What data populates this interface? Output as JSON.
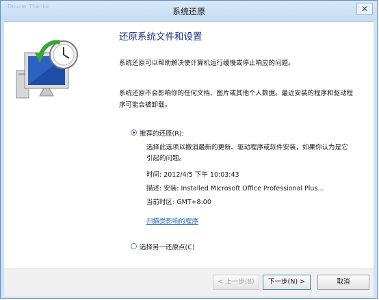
{
  "window": {
    "ghost_title": "Doucer Thankx",
    "title": "系统还原",
    "close_glyph": "✕"
  },
  "page": {
    "heading": "还原系统文件和设置",
    "intro": "系统还原可以帮助解决使计算机运行缓慢或停止响应的问题。",
    "note": "系统还原不会影响你的任何文档、图片或其他个人数据。最近安装的程序和驱动程序可能会被卸载。"
  },
  "recommended": {
    "label": "推荐的还原(R):",
    "selected": true,
    "description": "选择此选项以撤消最新的更新、驱动程序或软件安装，如果你认为是它引起的问题。",
    "time_line": "时间: 2012/4/5 下午 10:03:43",
    "description_line": "描述: 安装: Installed Microsoft Office Professional Plus...",
    "timezone_line": "当前时区: GMT+8:00",
    "scan_link": "扫描受影响的程序"
  },
  "other": {
    "label": "选择另一还原点(C)",
    "selected": false
  },
  "buttons": {
    "back": "< 上一步(B)",
    "next": "下一步(N) >",
    "cancel": "取消"
  },
  "colors": {
    "heading": "#1e3287",
    "link": "#1f5fbf",
    "frame": "#cfe2f5"
  },
  "icons": [
    "system-restore-icon",
    "close-icon"
  ]
}
